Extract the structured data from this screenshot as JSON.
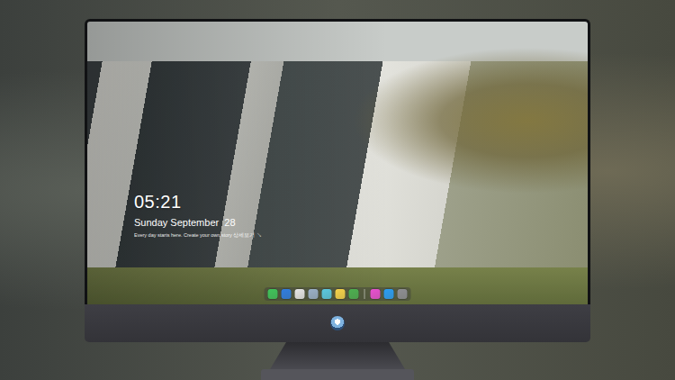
{
  "lock_screen": {
    "time": "05:21",
    "date": "Sunday September  28",
    "caption": "Every day starts here. Create your own story 상세보기 ↘"
  },
  "dock": {
    "items": [
      {
        "color": "#3fc35a",
        "kind": "app"
      },
      {
        "color": "#2f7de1",
        "kind": "app"
      },
      {
        "color": "#e6e6e6",
        "kind": "app"
      },
      {
        "color": "#9ab0c8",
        "kind": "app"
      },
      {
        "color": "#5ac8e0",
        "kind": "app"
      },
      {
        "color": "#f5d24a",
        "kind": "app"
      },
      {
        "color": "#4caf50",
        "kind": "app"
      },
      {
        "color": "#ffffff",
        "kind": "separator"
      },
      {
        "color": "#e84fd0",
        "kind": "app"
      },
      {
        "color": "#2a9df4",
        "kind": "app"
      },
      {
        "color": "#8e8e93",
        "kind": "app"
      }
    ]
  }
}
